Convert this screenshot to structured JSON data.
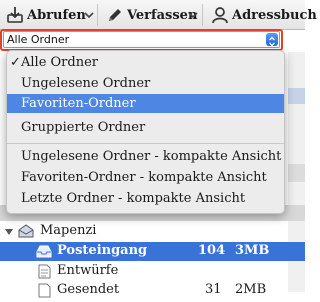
{
  "toolbar": {
    "fetch_label": "Abrufen",
    "compose_label": "Verfassen",
    "addressbook_label": "Adressbuch"
  },
  "folder_select": {
    "value": "Alle Ordner"
  },
  "menu": {
    "items": [
      {
        "label": "Alle Ordner",
        "checked": true
      },
      {
        "label": "Ungelesene Ordner"
      },
      {
        "label": "Favoriten-Ordner",
        "highlighted": true
      },
      {
        "label": "Gruppierte Ordner"
      },
      {
        "label": "Ungelesene Ordner - kompakte Ansicht"
      },
      {
        "label": "Favoriten-Ordner - kompakte Ansicht"
      },
      {
        "label": "Letzte Ordner - kompakte Ansicht"
      }
    ],
    "check_glyph": "✓"
  },
  "tree": {
    "account": "Mapenzi",
    "inbox": {
      "name": "Posteingang",
      "unread": "104",
      "size": "3MB"
    },
    "drafts": {
      "name": "Entwürfe"
    },
    "sent": {
      "name": "Gesendet",
      "unread": "31",
      "size": "2MB"
    }
  },
  "colors": {
    "selection": "#3a73d8",
    "menu_highlight": "#4e86e4",
    "focus_outline": "#e0432a"
  }
}
